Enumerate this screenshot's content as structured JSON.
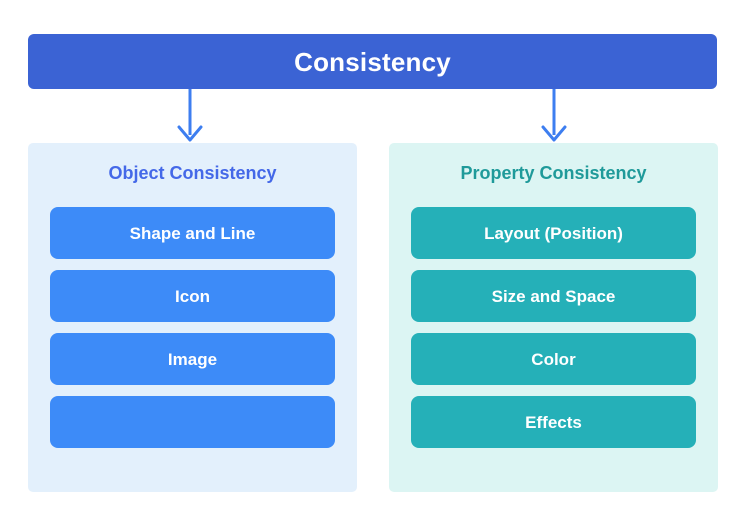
{
  "diagram": {
    "root": {
      "label": "Consistency",
      "color": "#3b63d4",
      "text_color": "#ffffff"
    },
    "connectors": [
      {
        "name": "arrow-to-object-consistency",
        "icon": "arrow-down-icon",
        "color": "#3d7ef0"
      },
      {
        "name": "arrow-to-property-consistency",
        "icon": "arrow-down-icon",
        "color": "#3d7ef0"
      }
    ],
    "branches": [
      {
        "title": "Object Consistency",
        "panel_color": "#e3f0fc",
        "title_color": "#4468e8",
        "item_color": "#3d8bf8",
        "items": [
          {
            "label": "Shape and Line"
          },
          {
            "label": "Icon"
          },
          {
            "label": "Image"
          },
          {
            "label": ""
          }
        ]
      },
      {
        "title": "Property Consistency",
        "panel_color": "#dcf5f3",
        "title_color": "#1f9a9a",
        "item_color": "#25b0b8",
        "items": [
          {
            "label": "Layout (Position)"
          },
          {
            "label": "Size and Space"
          },
          {
            "label": "Color"
          },
          {
            "label": "Effects"
          }
        ]
      }
    ]
  }
}
